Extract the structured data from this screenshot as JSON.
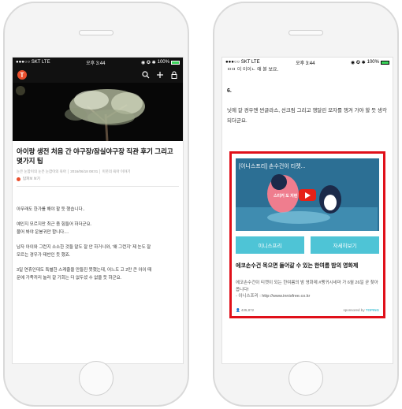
{
  "status_bar": {
    "carrier": "●●●○○ SKT  LTE",
    "time": "오후 3:44",
    "icons": "◉ ✪ ✱",
    "battery_text": "100%",
    "battery_level": 1.0
  },
  "left_screen": {
    "article_title": "아이랑 생전 처음 간 야구장/잠실야구장 직관 후기 그리고 몇가지 팁",
    "meta": "눈은 눈깜이의 눈은 눈깜이의 육아 │ 2016/06/18 08:01 │ 이웃의 육아 이야기",
    "author": "탑피보 보기",
    "paragraphs": [
      "아무래도 한가를 해야 할 듯 했습니다..",
      "예인지 모르지만 최근 좀 힘들어 하더군요.\n물어 봐야 운봉귀만 합니다....",
      "남자 아이와 그런지 소소한 것들 말도 잘 안 하거니와, '왜 그런지' 제 눈도 잘\n모르는 경우가 태반인 듯 했죠.",
      "3일 연휴인데도 특별한 스케줄을 만들진 못했는데, 어느도 고 2만 큰 아이 때\n문에 가족끼리 놀러 갈 기회는 더 없두셨 수 없을 듯 하군요."
    ]
  },
  "right_screen": {
    "cut_text": "ㅁㅁ 이 이이ㄴ 애 볼 보요.",
    "number": "6.",
    "text": "닛에 갈 경우엔 썬글라스, 선크림 그리고 챙달린 모자를 챙겨 가야 할 듯 생각되더군요.",
    "ad": {
      "video_title": "[이니스프리] 손수건이 티켓...",
      "video_caption": "스티커 도 저런 거던!",
      "button_primary": "이니스프리",
      "button_secondary": "자세히보기",
      "headline": "에코손수건 목으면 들어갈 수 있는 한여름 밤의 영화제",
      "description": "에코손수건이 티켓이 되는 한여름의 밤 영화제 #펭귀시네마 가 6월 26일 곧 찾아옵니다!\n- 이니스프리 : http://www.innisfree.co.kr",
      "views": "435,872",
      "sponsor_prefix": "sponsored by ",
      "sponsor_name": "TOPING",
      "highlight_color": "#e0101a",
      "button_color": "#4ec4d6"
    }
  }
}
